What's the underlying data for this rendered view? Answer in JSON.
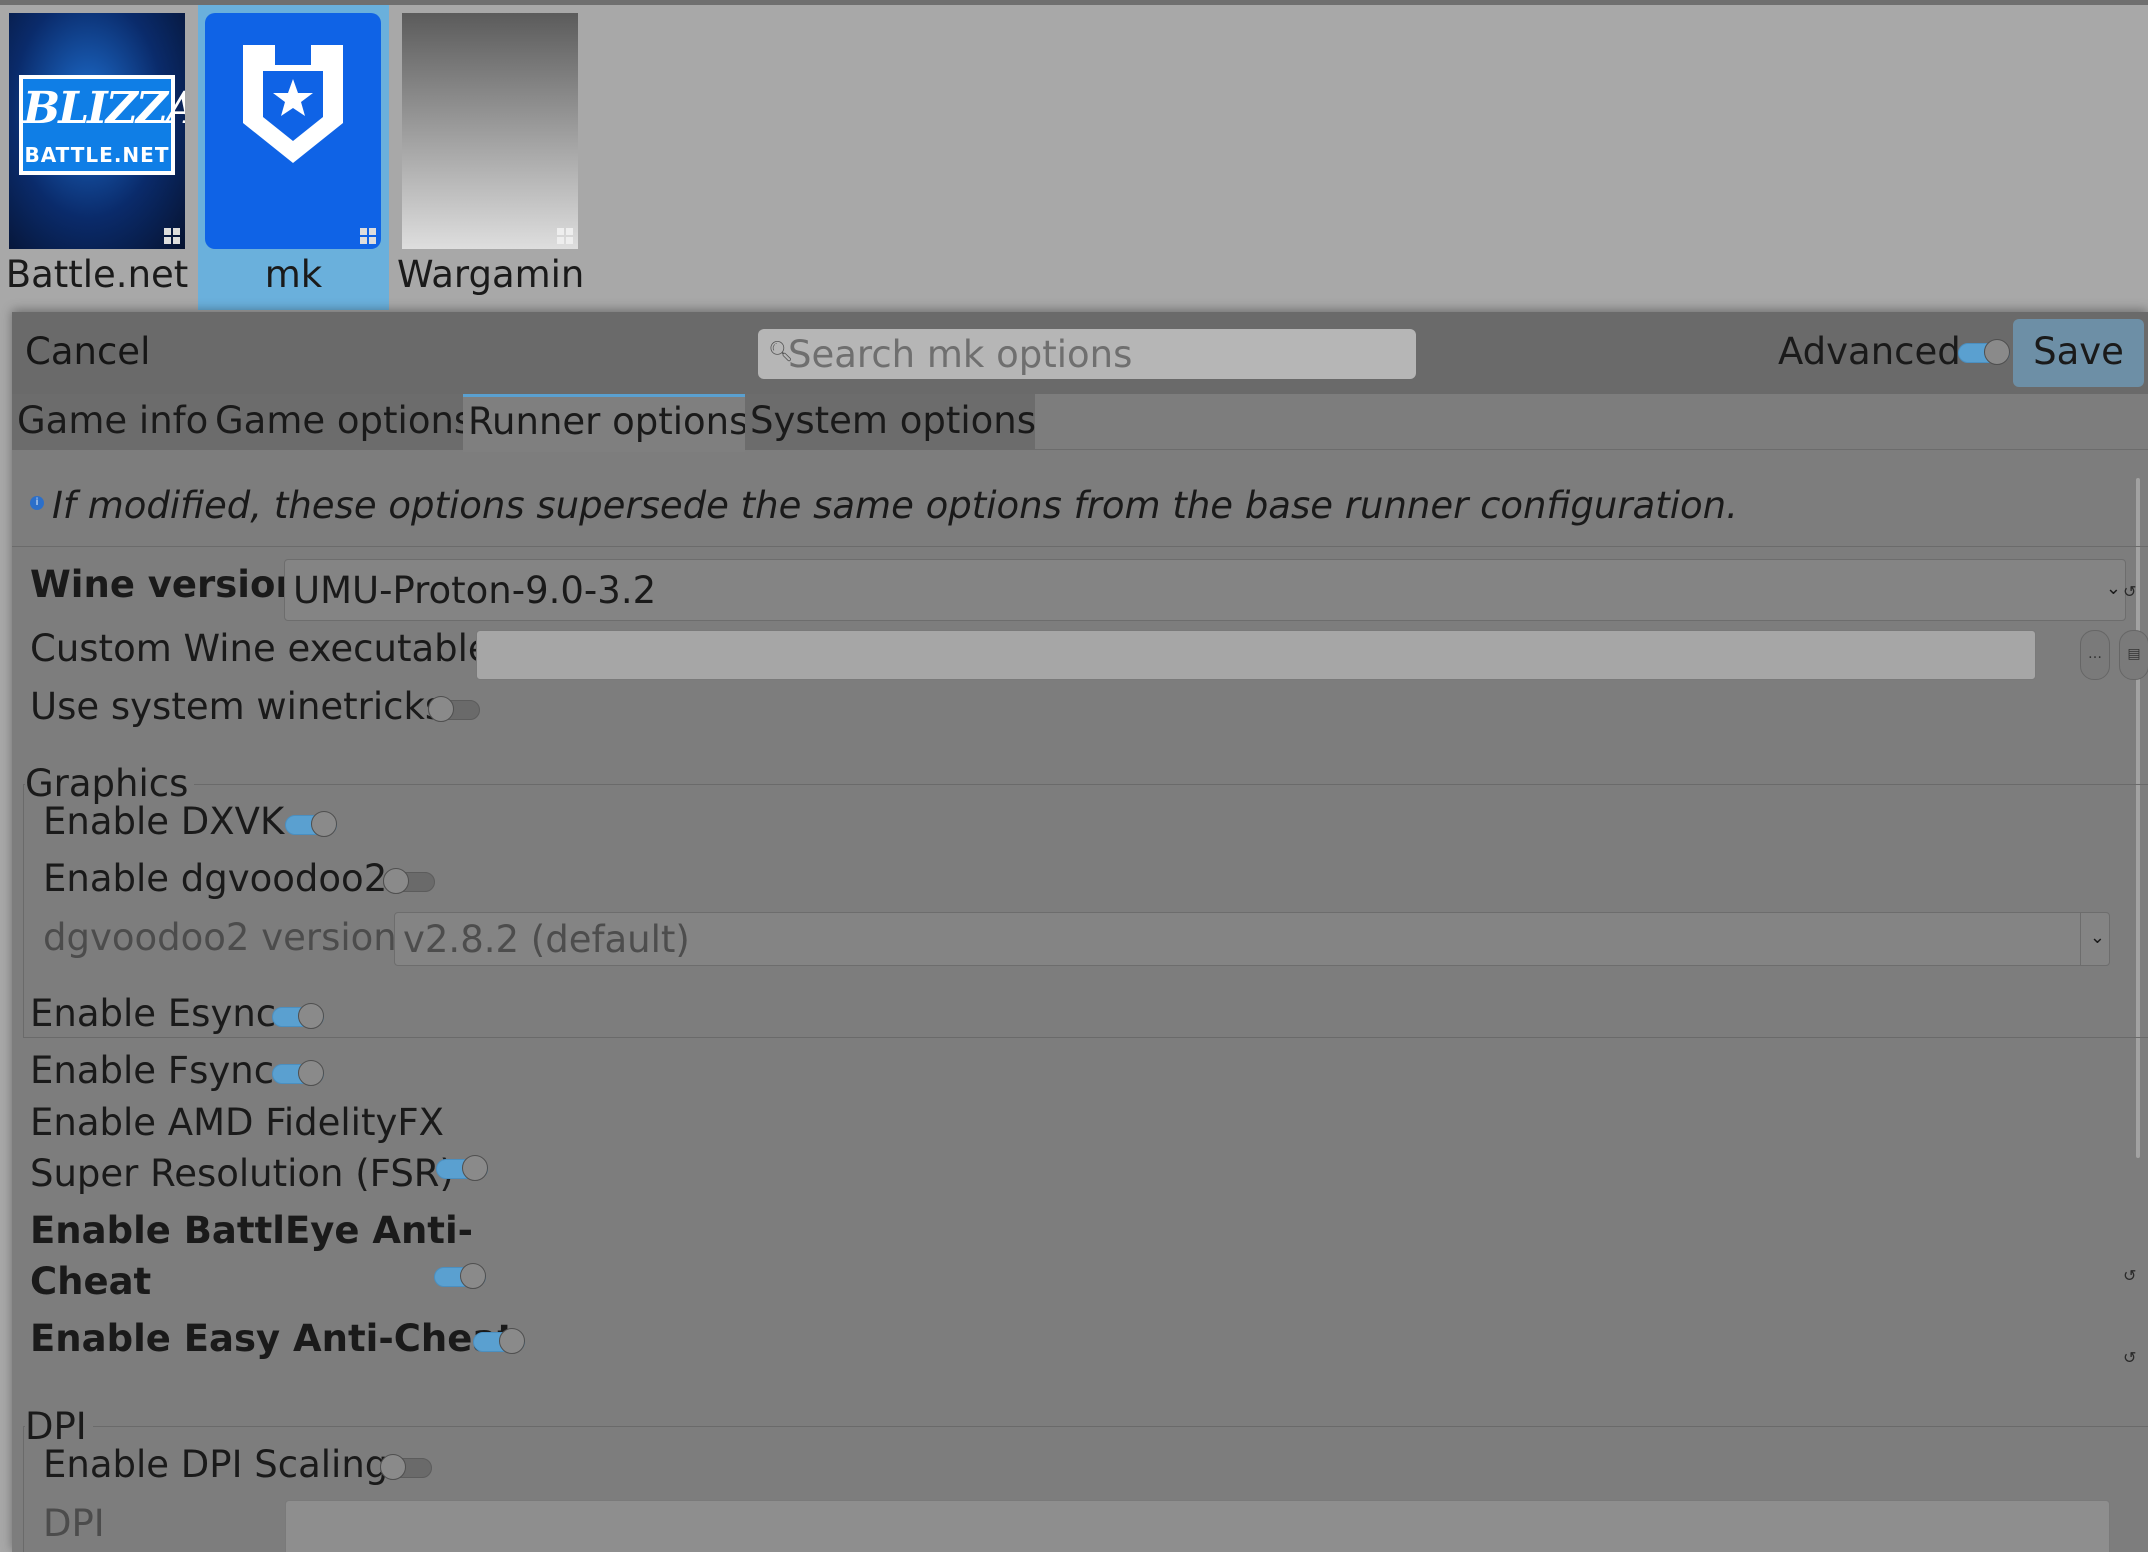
{
  "library": {
    "games": [
      {
        "name": "Battle.net",
        "logo_text": "BLIZZARD",
        "logo_subtext": "BATTLE.NET"
      },
      {
        "name": "mk"
      },
      {
        "name": "Wargaming"
      }
    ]
  },
  "dialog": {
    "cancel_label": "Cancel",
    "search_placeholder": "Search mk options",
    "advanced_label": "Advanced",
    "save_label": "Save",
    "tabs": [
      "Game info",
      "Game options",
      "Runner options",
      "System options"
    ],
    "active_tab": "Runner options",
    "info_text": "If modified, these options supersede the same options from the base runner configuration.",
    "wine_version": {
      "label": "Wine version",
      "value": "UMU-Proton-9.0-3.2"
    },
    "custom_wine": {
      "label": "Custom Wine executable",
      "value": ""
    },
    "system_winetricks": {
      "label": "Use system winetricks",
      "enabled": false
    },
    "graphics": {
      "title": "Graphics",
      "dxvk": {
        "label": "Enable DXVK",
        "enabled": true
      },
      "dgvoodoo2": {
        "label": "Enable dgvoodoo2",
        "enabled": false
      },
      "dgvoodoo2_version": {
        "label": "dgvoodoo2 version",
        "value": "v2.8.2 (default)"
      }
    },
    "esync": {
      "label": "Enable Esync",
      "enabled": true
    },
    "fsync": {
      "label": "Enable Fsync",
      "enabled": true
    },
    "fsr": {
      "label_line1": "Enable AMD FidelityFX",
      "label_line2": "Super Resolution (FSR)",
      "enabled": true
    },
    "battleye": {
      "label_line1": "Enable BattlEye Anti-",
      "label_line2": "Cheat",
      "enabled": true
    },
    "eac": {
      "label": "Enable Easy Anti-Cheat",
      "enabled": true
    },
    "dpi": {
      "title": "DPI",
      "scaling": {
        "label": "Enable DPI Scaling",
        "enabled": false
      },
      "dpi_value": {
        "label": "DPI",
        "value": ""
      }
    }
  },
  "colors": {
    "accent": "#5aa0d0",
    "selected": "#6ab0dc",
    "panel": "#7d7d7d"
  },
  "icons": [
    "windows-icon",
    "search-icon",
    "info-icon",
    "chevron-down-icon",
    "ellipsis-icon",
    "folder-icon",
    "reset-icon"
  ]
}
